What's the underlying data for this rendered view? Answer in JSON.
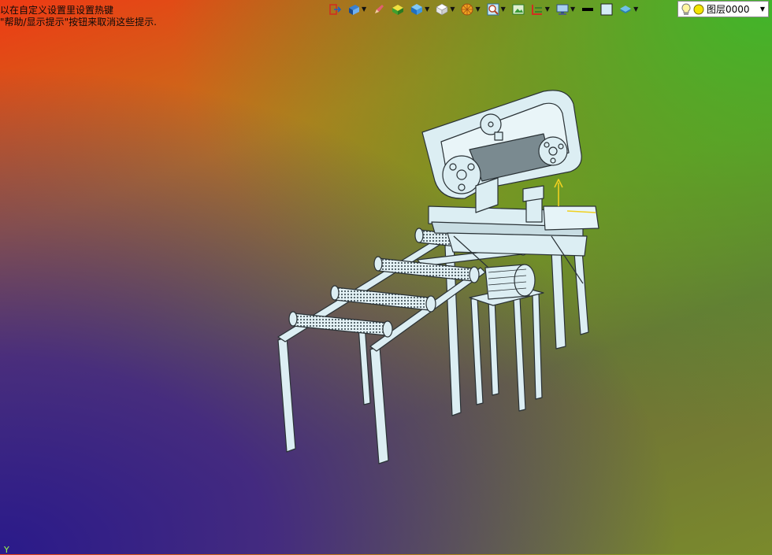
{
  "hints": {
    "line1": "以在自定义设置里设置热键",
    "line2": "\"帮助/显示提示\"按钮来取消这些提示."
  },
  "toolbar": {
    "items": [
      {
        "icon": "exit-icon",
        "dropdown": false
      },
      {
        "icon": "view-orient-icon",
        "dropdown": true
      },
      {
        "icon": "pen-icon",
        "dropdown": false
      },
      {
        "icon": "shaded-box-icon",
        "dropdown": false
      },
      {
        "icon": "cube-view-icon",
        "dropdown": true
      },
      {
        "icon": "white-cube-icon",
        "dropdown": true
      },
      {
        "icon": "render-sphere-icon",
        "dropdown": true
      },
      {
        "icon": "zoom-fit-icon",
        "dropdown": true
      },
      {
        "icon": "image-icon",
        "dropdown": false
      },
      {
        "icon": "section-icon",
        "dropdown": true
      },
      {
        "icon": "monitor-icon",
        "dropdown": true
      },
      {
        "icon": "line-color-icon",
        "dropdown": false
      },
      {
        "icon": "fill-color-icon",
        "dropdown": false
      },
      {
        "icon": "layer-stack-icon",
        "dropdown": true
      }
    ]
  },
  "layer": {
    "label": "图层0000"
  },
  "axis": {
    "y_label": "Y"
  },
  "colors": {
    "model_fill": "#dceef3",
    "model_edge": "#2a3236",
    "axis_yellow": "#f0d020"
  }
}
